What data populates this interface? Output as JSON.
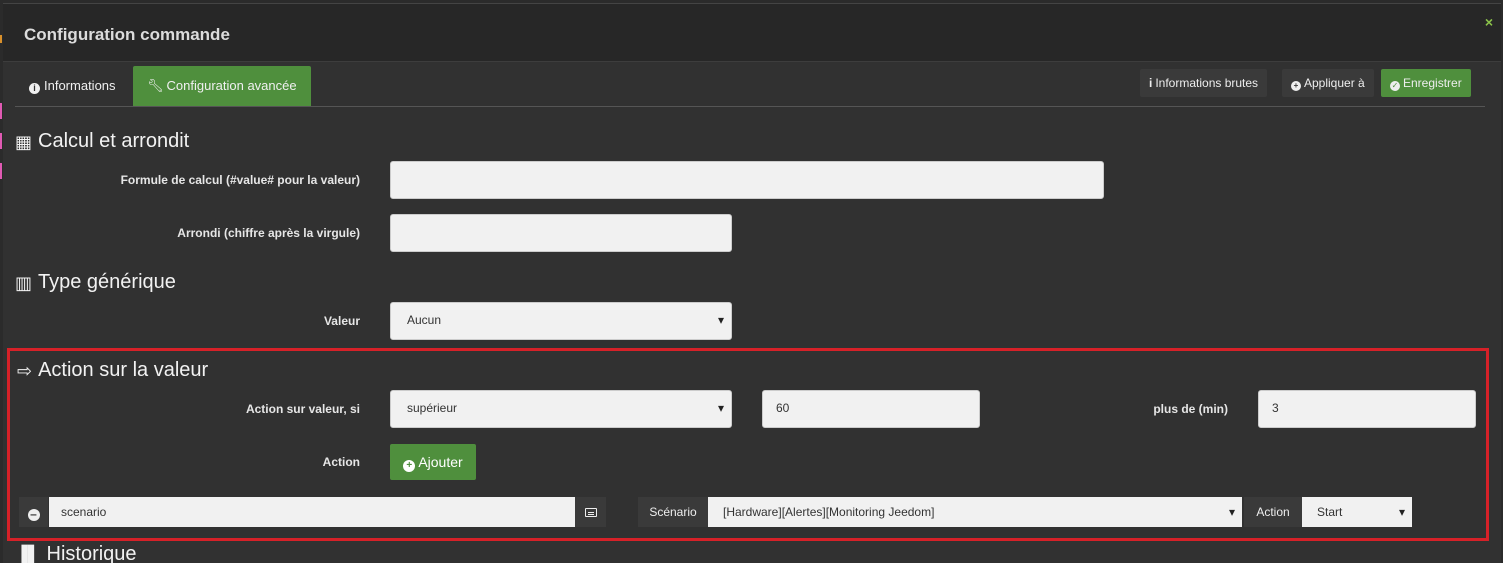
{
  "modal": {
    "title": "Configuration commande",
    "close": "×"
  },
  "tabs": {
    "informations": "Informations",
    "advanced": "Configuration avancée"
  },
  "toolbar": {
    "raw": "Informations brutes",
    "apply": "Appliquer à",
    "save": "Enregistrer"
  },
  "calc": {
    "title": "Calcul et arrondit",
    "formula_label": "Formule de calcul (#value# pour la valeur)",
    "formula_value": "",
    "round_label": "Arrondi (chiffre après la virgule)",
    "round_value": ""
  },
  "generic": {
    "title": "Type générique",
    "value_label": "Valeur",
    "value_selected": "Aucun"
  },
  "action": {
    "title": "Action sur la valeur",
    "condition_label": "Action sur valeur, si",
    "condition_selected": "supérieur",
    "threshold": "60",
    "duration_label": "plus de (min)",
    "duration": "3",
    "action_label": "Action",
    "add_button": "Ajouter",
    "row": {
      "command": "scenario",
      "scenario_label": "Scénario",
      "scenario_selected": "[Hardware][Alertes][Monitoring Jeedom]",
      "action_label": "Action",
      "action_selected": "Start"
    }
  },
  "history": {
    "title": "Historique"
  }
}
